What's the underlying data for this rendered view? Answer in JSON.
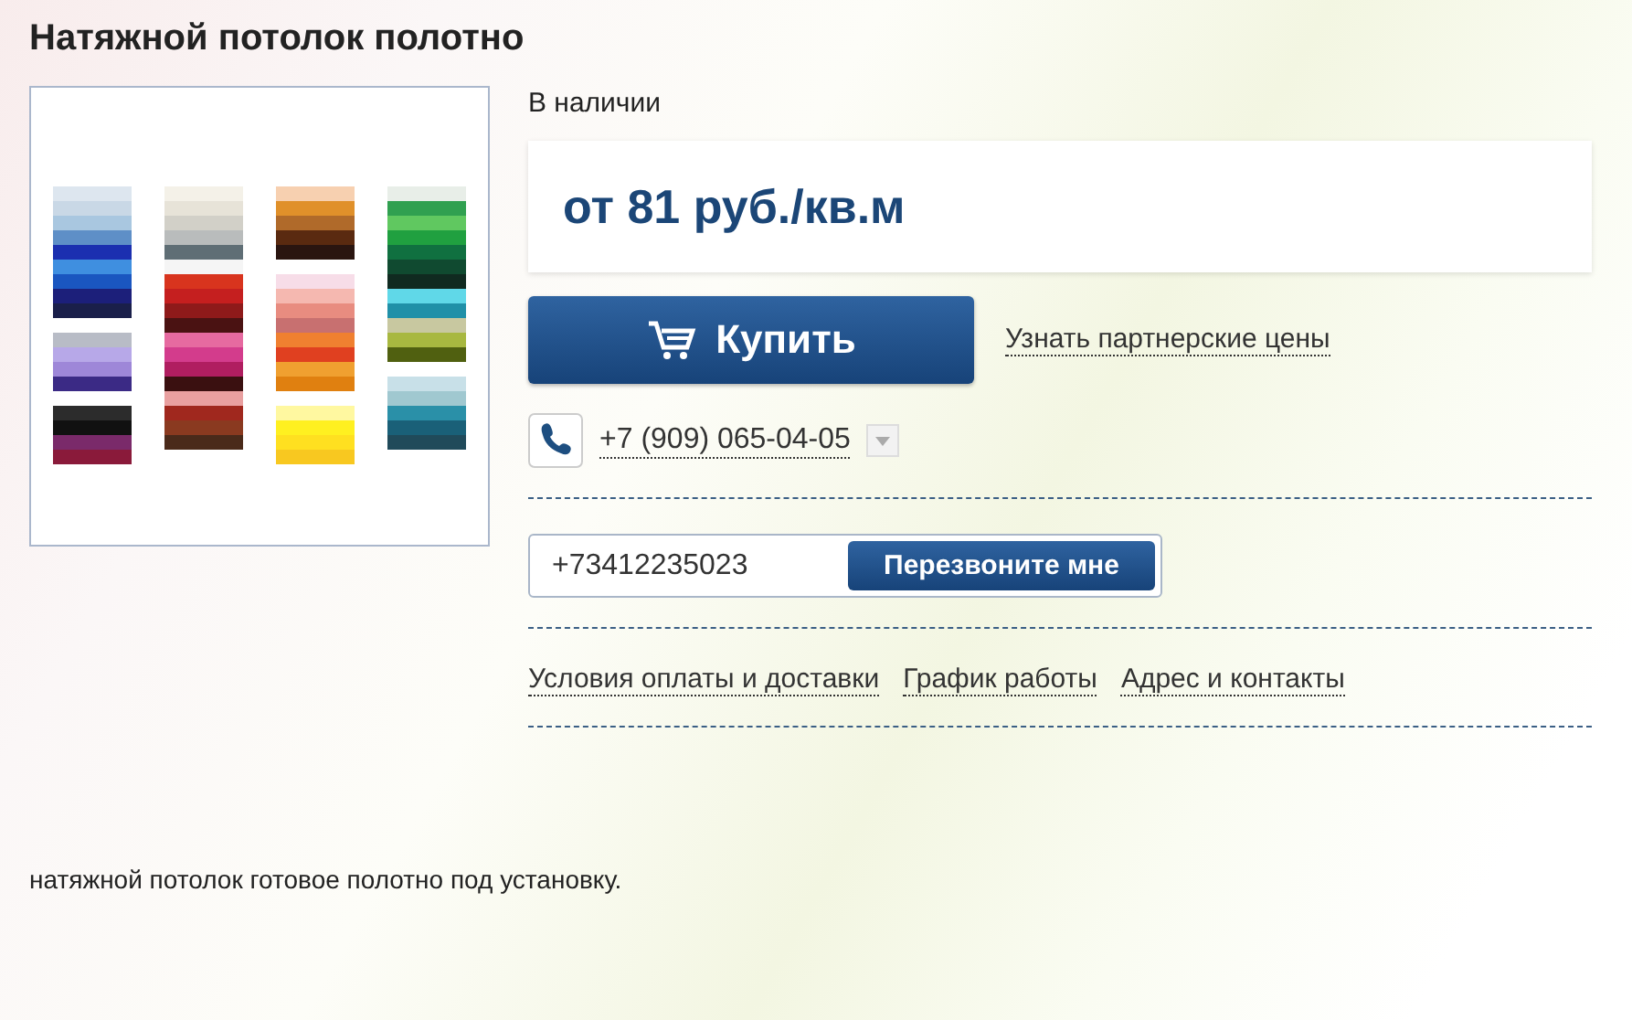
{
  "title": "Натяжной потолок полотно",
  "availability": "В наличии",
  "price": "от 81 руб./кв.м",
  "buy_button": "Купить",
  "partner_link": "Узнать партнерские цены",
  "phone": "+7 (909) 065-04-05",
  "callback": {
    "value": "+73412235023",
    "button": "Перезвоните мне"
  },
  "links": [
    "Условия оплаты и доставки",
    "График работы",
    "Адрес и контакты"
  ],
  "description": "натяжной потолок готовое полотно под установку."
}
